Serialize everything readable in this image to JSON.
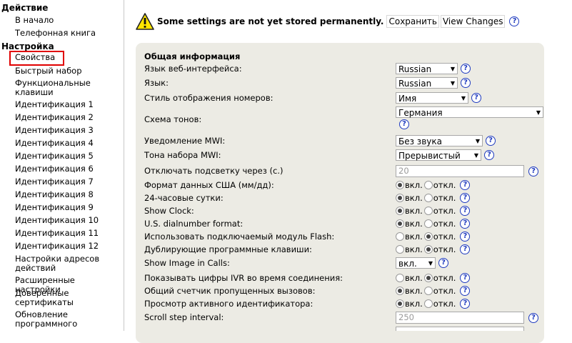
{
  "sidebar": {
    "action_heading": "Действие",
    "action_items": [
      "В начало",
      "Телефонная книга"
    ],
    "settings_heading": "Настройка",
    "settings_items": [
      "Свойства",
      "Быстрый набор",
      "Функциональные клавиши",
      "Идентификация 1",
      "Идентификация 2",
      "Идентификация 3",
      "Идентификация 4",
      "Идентификация 5",
      "Идентификация 6",
      "Идентификация 7",
      "Идентификация 8",
      "Идентификация 9",
      "Идентификация 10",
      "Идентификация 11",
      "Идентификация 12",
      "Настройки адресов действий",
      "Расширенные настройки",
      "Доверенные сертификаты",
      "Обновление программного"
    ]
  },
  "warning": {
    "text": "Some settings are not yet stored permanently.",
    "save_label": "Сохранить",
    "view_changes_label": "View Changes",
    "help": "?"
  },
  "panel": {
    "title": "Общая информация",
    "on_label": "вкл.",
    "off_label": "откл.",
    "help": "?",
    "rows": {
      "web_lang": {
        "label": "Язык веб-интерфейса:",
        "value": "Russian"
      },
      "lang": {
        "label": "Язык:",
        "value": "Russian"
      },
      "number_style": {
        "label": "Стиль отображения номеров:",
        "value": "Имя"
      },
      "tone_scheme": {
        "label": "Схема тонов:",
        "value": "Германия"
      },
      "mwi_notify": {
        "label": "Уведомление MWI:",
        "value": "Без звука"
      },
      "mwi_tone": {
        "label": "Тона набора MWI:",
        "value": "Прерывистый"
      },
      "backlight": {
        "label": "Отключать подсветку через (с.)",
        "value": "20"
      },
      "us_date": {
        "label": "Формат данных США (мм/дд):",
        "selected": "on"
      },
      "clock24": {
        "label": "24-часовые сутки:",
        "selected": "on"
      },
      "show_clock": {
        "label": "Show Clock:",
        "selected": "on"
      },
      "us_dialnumber": {
        "label": "U.S. dialnumber format:",
        "selected": "on"
      },
      "flash_module": {
        "label": "Использовать подключаемый модуль Flash:",
        "selected": "off"
      },
      "dup_softkeys": {
        "label": "Дублирующие программные клавиши:",
        "selected": "off"
      },
      "image_in_calls": {
        "label": "Show Image in Calls:",
        "value": "вкл."
      },
      "ivr_digits": {
        "label": "Показывать цифры IVR во время соединения:",
        "selected": "off"
      },
      "missed_counter": {
        "label": "Общий счетчик пропущенных вызовов:",
        "selected": "on"
      },
      "active_ident": {
        "label": "Просмотр активного идентификатора:",
        "selected": "on"
      },
      "scroll_step": {
        "label": "Scroll step interval:",
        "value": "250"
      }
    }
  }
}
